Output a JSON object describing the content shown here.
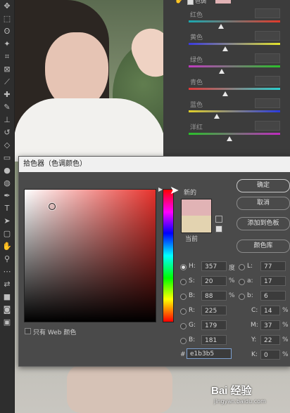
{
  "dialog": {
    "title": "拾色器（色调颜色）",
    "new_label": "新的",
    "current_label": "当前",
    "new_color": "#e1b3b5",
    "current_color": "#e3d3b0",
    "buttons": {
      "ok": "确定",
      "cancel": "取消",
      "add_swatch": "添加到色板",
      "libraries": "颜色库"
    },
    "web_only_label": "只有 Web 颜色",
    "hex_prefix": "#",
    "hex_value": "e1b3b5",
    "hsb": [
      {
        "label": "H:",
        "value": "357",
        "unit": "度",
        "selected": true
      },
      {
        "label": "S:",
        "value": "20",
        "unit": "%",
        "selected": false
      },
      {
        "label": "B:",
        "value": "88",
        "unit": "%",
        "selected": false
      }
    ],
    "rgb": [
      {
        "label": "R:",
        "value": "225"
      },
      {
        "label": "G:",
        "value": "179"
      },
      {
        "label": "B:",
        "value": "181"
      }
    ],
    "lab": [
      {
        "label": "L:",
        "value": "77"
      },
      {
        "label": "a:",
        "value": "17"
      },
      {
        "label": "b:",
        "value": "6"
      }
    ],
    "cmyk": [
      {
        "label": "C:",
        "value": "14",
        "unit": "%"
      },
      {
        "label": "M:",
        "value": "37",
        "unit": "%"
      },
      {
        "label": "Y:",
        "value": "22",
        "unit": "%"
      },
      {
        "label": "K:",
        "value": "0",
        "unit": "%"
      }
    ]
  },
  "color_balance": {
    "top_label": "色调",
    "rows": [
      {
        "label": "红色",
        "value": ""
      },
      {
        "label": "黄色",
        "value": ""
      },
      {
        "label": "绿色",
        "value": ""
      },
      {
        "label": "青色",
        "value": ""
      },
      {
        "label": "蓝色",
        "value": ""
      },
      {
        "label": "洋红",
        "value": ""
      }
    ]
  },
  "watermark": {
    "logo": "Bai 经验",
    "url": "jingyan.baidu.com"
  }
}
